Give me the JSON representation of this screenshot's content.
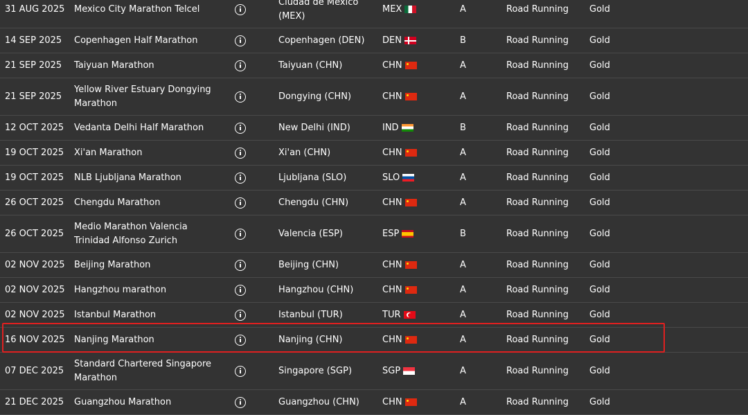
{
  "highlight_color": "#e02020",
  "rows": [
    {
      "date": "31 AUG 2025",
      "name": "Mexico City Marathon Telcel",
      "location": "Ciudad de México (MEX)",
      "country": "MEX",
      "flag": "mex",
      "category": "A",
      "type": "Road Running",
      "label": "Gold"
    },
    {
      "date": "14 SEP 2025",
      "name": "Copenhagen Half Marathon",
      "location": "Copenhagen (DEN)",
      "country": "DEN",
      "flag": "den",
      "category": "B",
      "type": "Road Running",
      "label": "Gold"
    },
    {
      "date": "21 SEP 2025",
      "name": "Taiyuan Marathon",
      "location": "Taiyuan (CHN)",
      "country": "CHN",
      "flag": "chn",
      "category": "A",
      "type": "Road Running",
      "label": "Gold"
    },
    {
      "date": "21 SEP 2025",
      "name": "Yellow River Estuary Dongying Marathon",
      "location": "Dongying (CHN)",
      "country": "CHN",
      "flag": "chn",
      "category": "A",
      "type": "Road Running",
      "label": "Gold"
    },
    {
      "date": "12 OCT 2025",
      "name": "Vedanta Delhi Half Marathon",
      "location": "New Delhi (IND)",
      "country": "IND",
      "flag": "ind",
      "category": "B",
      "type": "Road Running",
      "label": "Gold"
    },
    {
      "date": "19 OCT 2025",
      "name": "Xi'an Marathon",
      "location": "Xi'an (CHN)",
      "country": "CHN",
      "flag": "chn",
      "category": "A",
      "type": "Road Running",
      "label": "Gold"
    },
    {
      "date": "19 OCT 2025",
      "name": "NLB Ljubljana Marathon",
      "location": "Ljubljana (SLO)",
      "country": "SLO",
      "flag": "slo",
      "category": "A",
      "type": "Road Running",
      "label": "Gold"
    },
    {
      "date": "26 OCT 2025",
      "name": "Chengdu Marathon",
      "location": "Chengdu (CHN)",
      "country": "CHN",
      "flag": "chn",
      "category": "A",
      "type": "Road Running",
      "label": "Gold"
    },
    {
      "date": "26 OCT 2025",
      "name": "Medio Marathon Valencia Trinidad Alfonso Zurich",
      "location": "Valencia (ESP)",
      "country": "ESP",
      "flag": "esp",
      "category": "B",
      "type": "Road Running",
      "label": "Gold"
    },
    {
      "date": "02 NOV 2025",
      "name": "Beijing Marathon",
      "location": "Beijing (CHN)",
      "country": "CHN",
      "flag": "chn",
      "category": "A",
      "type": "Road Running",
      "label": "Gold"
    },
    {
      "date": "02 NOV 2025",
      "name": "Hangzhou marathon",
      "location": "Hangzhou (CHN)",
      "country": "CHN",
      "flag": "chn",
      "category": "A",
      "type": "Road Running",
      "label": "Gold"
    },
    {
      "date": "02 NOV 2025",
      "name": "Istanbul Marathon",
      "location": "Istanbul (TUR)",
      "country": "TUR",
      "flag": "tur",
      "category": "A",
      "type": "Road Running",
      "label": "Gold"
    },
    {
      "date": "16 NOV 2025",
      "name": "Nanjing Marathon",
      "location": "Nanjing (CHN)",
      "country": "CHN",
      "flag": "chn",
      "category": "A",
      "type": "Road Running",
      "label": "Gold",
      "highlighted": true
    },
    {
      "date": "07 DEC 2025",
      "name": "Standard Chartered Singapore Marathon",
      "location": "Singapore (SGP)",
      "country": "SGP",
      "flag": "sgp",
      "category": "A",
      "type": "Road Running",
      "label": "Gold"
    },
    {
      "date": "21 DEC 2025",
      "name": "Guangzhou Marathon",
      "location": "Guangzhou (CHN)",
      "country": "CHN",
      "flag": "chn",
      "category": "A",
      "type": "Road Running",
      "label": "Gold"
    }
  ]
}
